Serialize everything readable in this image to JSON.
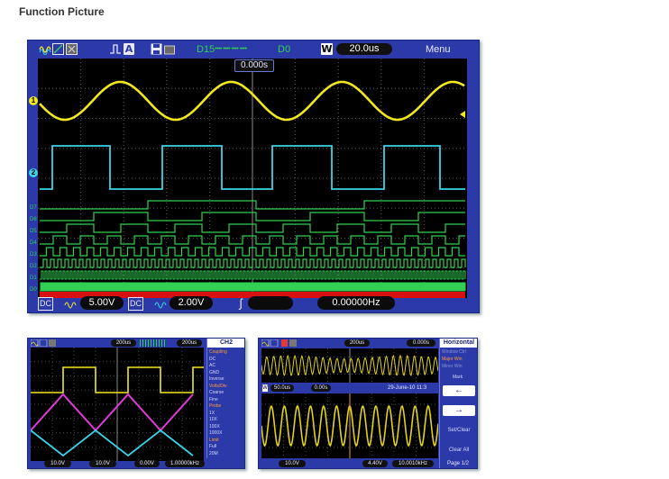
{
  "page": {
    "heading": "Function Picture"
  },
  "main_scope": {
    "topbar": {
      "run_mode_icons": [
        "waveform-icon",
        "ramp-icon",
        "grid-icon"
      ],
      "trigger_label": "A",
      "save_icon": "floppy-icon",
      "digital_range_start": "D15",
      "digital_range_dots": "•••• •••• •••• ••••",
      "digital_range_end": "D0",
      "timebase_label": "W",
      "timebase_value": "20.0us",
      "menu_label": "Menu"
    },
    "trigger_position": "0.000s",
    "channel_markers": {
      "ch1": "1",
      "ch2": "2"
    },
    "digital_labels": [
      "D7",
      "D6",
      "D5",
      "D4",
      "D3",
      "D2",
      "D1",
      "D0"
    ],
    "bottombar": {
      "ch1_coupling": "DC",
      "ch1_scale": "5.00V",
      "ch2_coupling": "DC",
      "ch2_scale": "2.00V",
      "trigger_edge": "∫",
      "trigger_level": "",
      "frequency": "0.00000Hz"
    },
    "colors": {
      "ch1": "#f2e81c",
      "ch2": "#3ad4e8",
      "digital": "#32d052",
      "digital_bus": "#d81010",
      "frame": "#2b3aa8"
    }
  },
  "scope_ch2": {
    "topbar": {
      "timebase": "200us",
      "window": "200us"
    },
    "menu_title": "CH2",
    "menu_items": [
      "Coupling",
      "DC",
      "AC",
      "GND",
      "Inverse",
      "Volts/Div",
      "Coarse",
      "Fine",
      "Probe",
      "1X",
      "10X",
      "100X",
      "1000X",
      "Limit",
      "Full",
      "20M"
    ],
    "bottombar": {
      "ch1": "10.0V",
      "ch2": "10.0V",
      "level": "0.00V",
      "freq": "1.00000kHz"
    },
    "colors": {
      "ch1": "#f2e81c",
      "ch2": "#e23ad8",
      "ch3": "#3ad4e8"
    }
  },
  "scope_horizontal": {
    "topbar": {
      "timebase": "200us",
      "offset": "0.000s"
    },
    "zoom_bar": {
      "label": "W",
      "window": "50.0us",
      "position": "0.00s",
      "timestamp": "29-June-10 11:3"
    },
    "menu_title": "Horizontal",
    "menu_items": [
      "Window Ctrl",
      "Major Win",
      "Minor Win",
      "Mark"
    ],
    "menu_buttons": [
      "←",
      "→",
      "Set/Clear",
      "Clear All"
    ],
    "page_label": "Page 1/2",
    "bottombar": {
      "ch1": "10.0V",
      "level": "4.40V",
      "freq": "10.0010kHz"
    },
    "colors": {
      "wave": "#e2d21c"
    }
  }
}
